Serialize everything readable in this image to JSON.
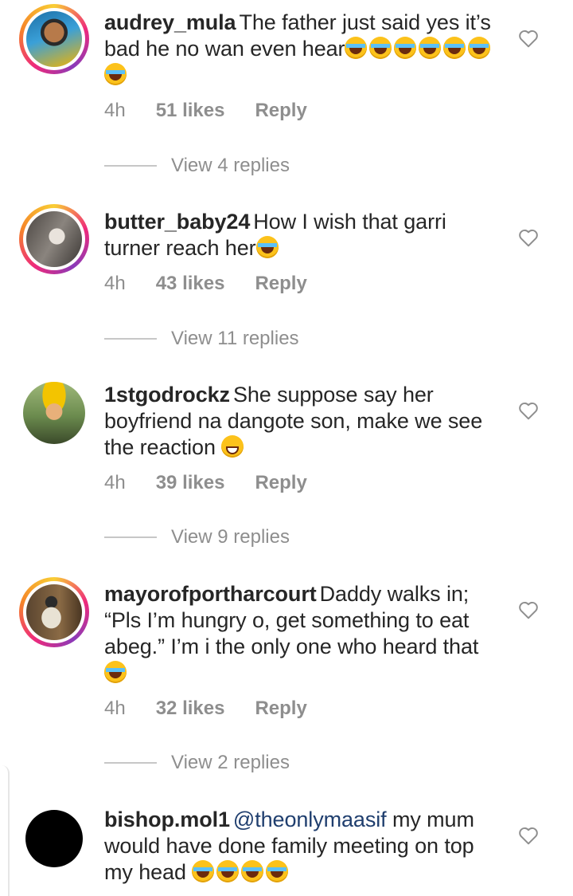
{
  "comments": [
    {
      "username": "audrey_mula",
      "mention": "",
      "text": "The father just said yes it’s bad he no wan even hear",
      "emoji_count": 7,
      "time": "4h",
      "likes": "51 likes",
      "reply": "Reply",
      "view_replies": "View 4 replies",
      "avatar_colors": [
        "#1d6fa6",
        "#f4b400"
      ]
    },
    {
      "username": "butter_baby24",
      "mention": "",
      "text": "How I wish that garri turner reach her",
      "emoji_count": 1,
      "time": "4h",
      "likes": "43 likes",
      "reply": "Reply",
      "view_replies": "View 11 replies",
      "avatar_colors": [
        "#6f6a65",
        "#e9e3dc"
      ]
    },
    {
      "username": "1stgodrockz",
      "mention": "",
      "text": "She suppose say her boyfriend na dangote son, make we see the reaction",
      "emoji_count": 1,
      "time": "4h",
      "likes": "39 likes",
      "reply": "Reply",
      "view_replies": "View 9 replies",
      "avatar_colors": [
        "#6b8b4e",
        "#f3c400"
      ]
    },
    {
      "username": "mayorofportharcourt",
      "mention": "",
      "text": "Daddy walks in; “Pls I’m hungry o, get something to eat abeg.” I’m i the only one who heard that",
      "emoji_count": 1,
      "time": "4h",
      "likes": "32 likes",
      "reply": "Reply",
      "view_replies": "View 2 replies",
      "avatar_colors": [
        "#7a5e3b",
        "#e8e2d4"
      ]
    },
    {
      "username": "bishop.mol1",
      "mention": "@theonlymaasif",
      "text": "my mum would have done family meeting on top my head",
      "emoji_count": 4,
      "time": "",
      "likes": "",
      "reply": "",
      "view_replies": "",
      "avatar_colors": [
        "#000000",
        "#000000"
      ]
    }
  ]
}
